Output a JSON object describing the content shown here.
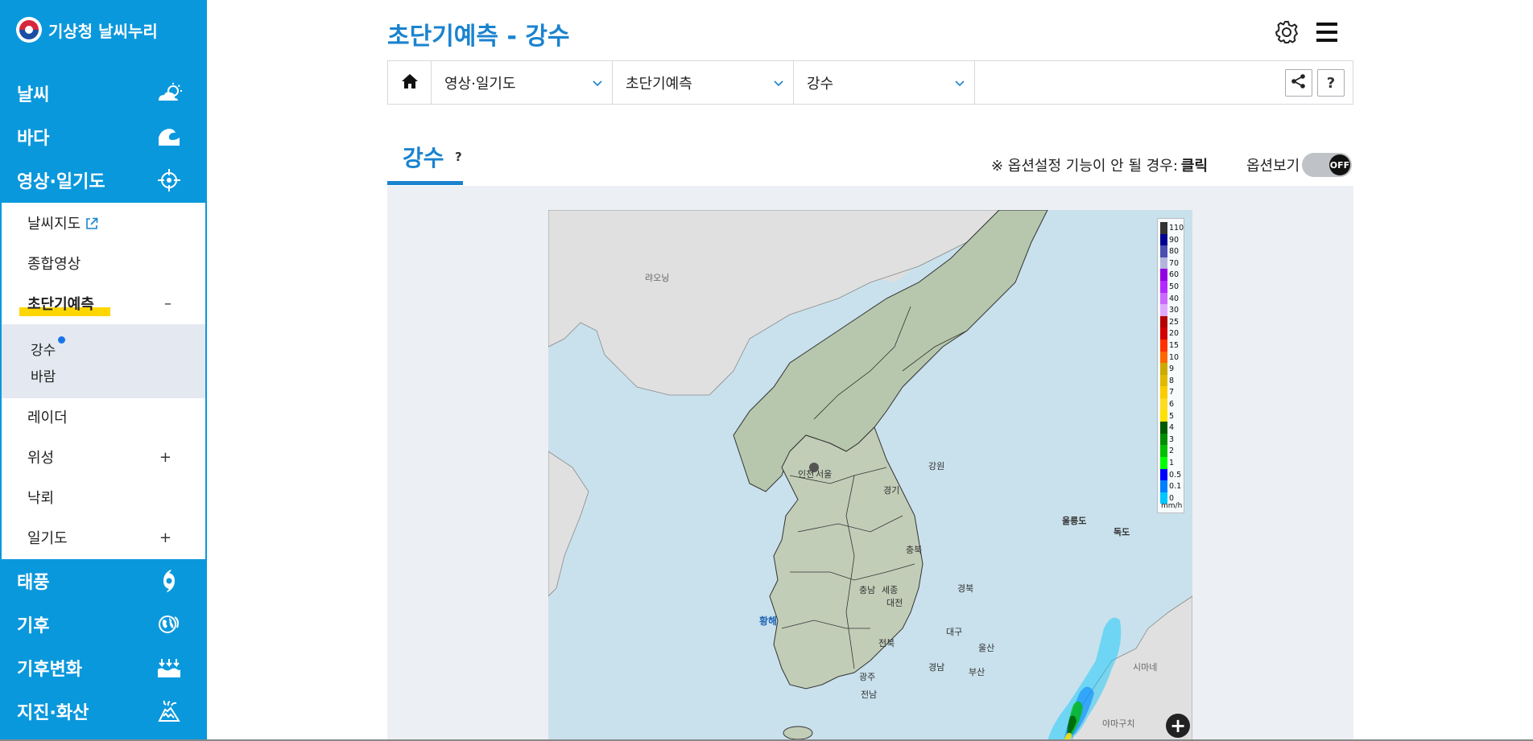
{
  "app": {
    "logo_text": "기상청 날씨누리"
  },
  "sidebar": {
    "main_items": [
      {
        "label": "날씨",
        "icon": "sun-cloud-icon"
      },
      {
        "label": "바다",
        "icon": "wave-icon"
      },
      {
        "label": "영상·일기도",
        "icon": "target-icon"
      },
      {
        "label": "태풍",
        "icon": "typhoon-icon"
      },
      {
        "label": "기후",
        "icon": "globe-icon"
      },
      {
        "label": "기후변화",
        "icon": "water-arrows-icon"
      },
      {
        "label": "지진·화산",
        "icon": "volcano-icon"
      }
    ],
    "sub_items": [
      {
        "label": "날씨지도"
      },
      {
        "label": "종합영상"
      },
      {
        "label": "초단기예측",
        "toggle": "–"
      },
      {
        "label": "레이더"
      },
      {
        "label": "위성",
        "toggle": "+"
      },
      {
        "label": "낙뢰"
      },
      {
        "label": "일기도",
        "toggle": "+"
      }
    ],
    "sub2_items": [
      {
        "label": "강수"
      },
      {
        "label": "바람"
      }
    ]
  },
  "header": {
    "title": "초단기예측 - 강수"
  },
  "breadcrumb": {
    "level1": "영상·일기도",
    "level2": "초단기예측",
    "level3": "강수",
    "help_label": "?"
  },
  "tab": {
    "label": "강수",
    "help": "?"
  },
  "options": {
    "note_prefix": "※ 옵션설정 기능이 안 될 경우:",
    "note_link": "클릭",
    "label": "옵션보기",
    "toggle_state": "OFF"
  },
  "map": {
    "labels": {
      "liaoning": "랴오닝",
      "incheon": "인천",
      "seoul": "서울",
      "gyeonggi": "경기",
      "gangwon": "강원",
      "ulleungdo": "울릉도",
      "dokdo": "독도",
      "chungbuk": "충북",
      "chungnam": "충남",
      "sejong": "세종",
      "daejeon": "대전",
      "gyeongbuk": "경북",
      "yellow_sea": "황해",
      "jeonbuk": "전북",
      "daegu": "대구",
      "ulsan": "울산",
      "gyeongnam": "경남",
      "busan": "부산",
      "gwangju": "광주",
      "jeonnam": "전남",
      "shimane": "시마네",
      "yamaguchi": "야마구치"
    },
    "zoom_label": "+"
  },
  "legend": {
    "unit": "mm/h",
    "entries": [
      {
        "value": "110",
        "color": "#333333"
      },
      {
        "value": "90",
        "color": "#000390"
      },
      {
        "value": "80",
        "color": "#4c4eb1"
      },
      {
        "value": "70",
        "color": "#b3b4de"
      },
      {
        "value": "60",
        "color": "#9300e4"
      },
      {
        "value": "50",
        "color": "#b329ff"
      },
      {
        "value": "40",
        "color": "#c969ff"
      },
      {
        "value": "30",
        "color": "#e0a9ff"
      },
      {
        "value": "25",
        "color": "#b40000"
      },
      {
        "value": "20",
        "color": "#d20000"
      },
      {
        "value": "15",
        "color": "#ff3200"
      },
      {
        "value": "10",
        "color": "#ff6600"
      },
      {
        "value": "9",
        "color": "#ccaa00"
      },
      {
        "value": "8",
        "color": "#e0b900"
      },
      {
        "value": "7",
        "color": "#f9cd00"
      },
      {
        "value": "6",
        "color": "#ffdc1f"
      },
      {
        "value": "5",
        "color": "#ffe100"
      },
      {
        "value": "4",
        "color": "#005a00"
      },
      {
        "value": "3",
        "color": "#008c00"
      },
      {
        "value": "2",
        "color": "#00be00"
      },
      {
        "value": "1",
        "color": "#00ff00"
      },
      {
        "value": "0.5",
        "color": "#0000ff"
      },
      {
        "value": "0.1",
        "color": "#0080ff"
      },
      {
        "value": "0",
        "color": "#00c7ff"
      }
    ]
  },
  "colors": {
    "sidebar_bg": "#0a98dc",
    "accent": "#1a83cf",
    "highlight": "#ffd600"
  }
}
